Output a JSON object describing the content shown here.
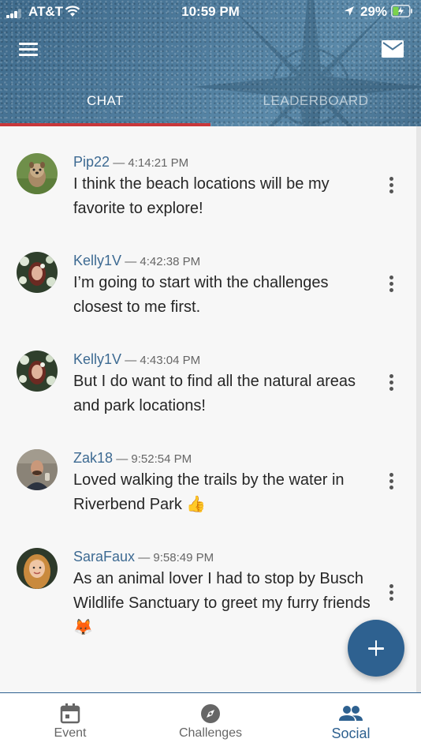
{
  "status_bar": {
    "carrier": "AT&T",
    "time": "10:59 PM",
    "battery": "29%"
  },
  "header": {
    "menu_icon": "hamburger-menu-icon",
    "mail_icon": "mail-icon",
    "tabs": [
      {
        "label": "CHAT",
        "active": true
      },
      {
        "label": "LEADERBOARD",
        "active": false
      }
    ],
    "accent_color": "#c8373a"
  },
  "messages": [
    {
      "user": "Pip22",
      "separator": "—",
      "time": "4:14:21 PM",
      "text": "I think the beach locations will be my favorite to explore!"
    },
    {
      "user": "Kelly1V",
      "separator": "—",
      "time": "4:42:38 PM",
      "text": "I’m going to start with the challenges closest to me first."
    },
    {
      "user": "Kelly1V",
      "separator": "—",
      "time": "4:43:04 PM",
      "text": "But I do want to find all the natural areas and park locations!"
    },
    {
      "user": "Zak18",
      "separator": "—",
      "time": "9:52:54 PM",
      "text": "Loved walking the trails by the water in Riverbend Park 👍"
    },
    {
      "user": "SaraFaux",
      "separator": "—",
      "time": "9:58:49 PM",
      "text": "As an animal lover I had to stop by Busch Wildlife Sanctuary to greet my furry friends 🦊"
    }
  ],
  "fab": {
    "icon": "plus-icon"
  },
  "bottom_nav": [
    {
      "label": "Event",
      "icon": "calendar-icon"
    },
    {
      "label": "Challenges",
      "icon": "compass-icon"
    },
    {
      "label": "Social",
      "icon": "people-icon",
      "active": true
    }
  ],
  "colors": {
    "primary": "#2e6190",
    "username": "#3d6a92"
  }
}
